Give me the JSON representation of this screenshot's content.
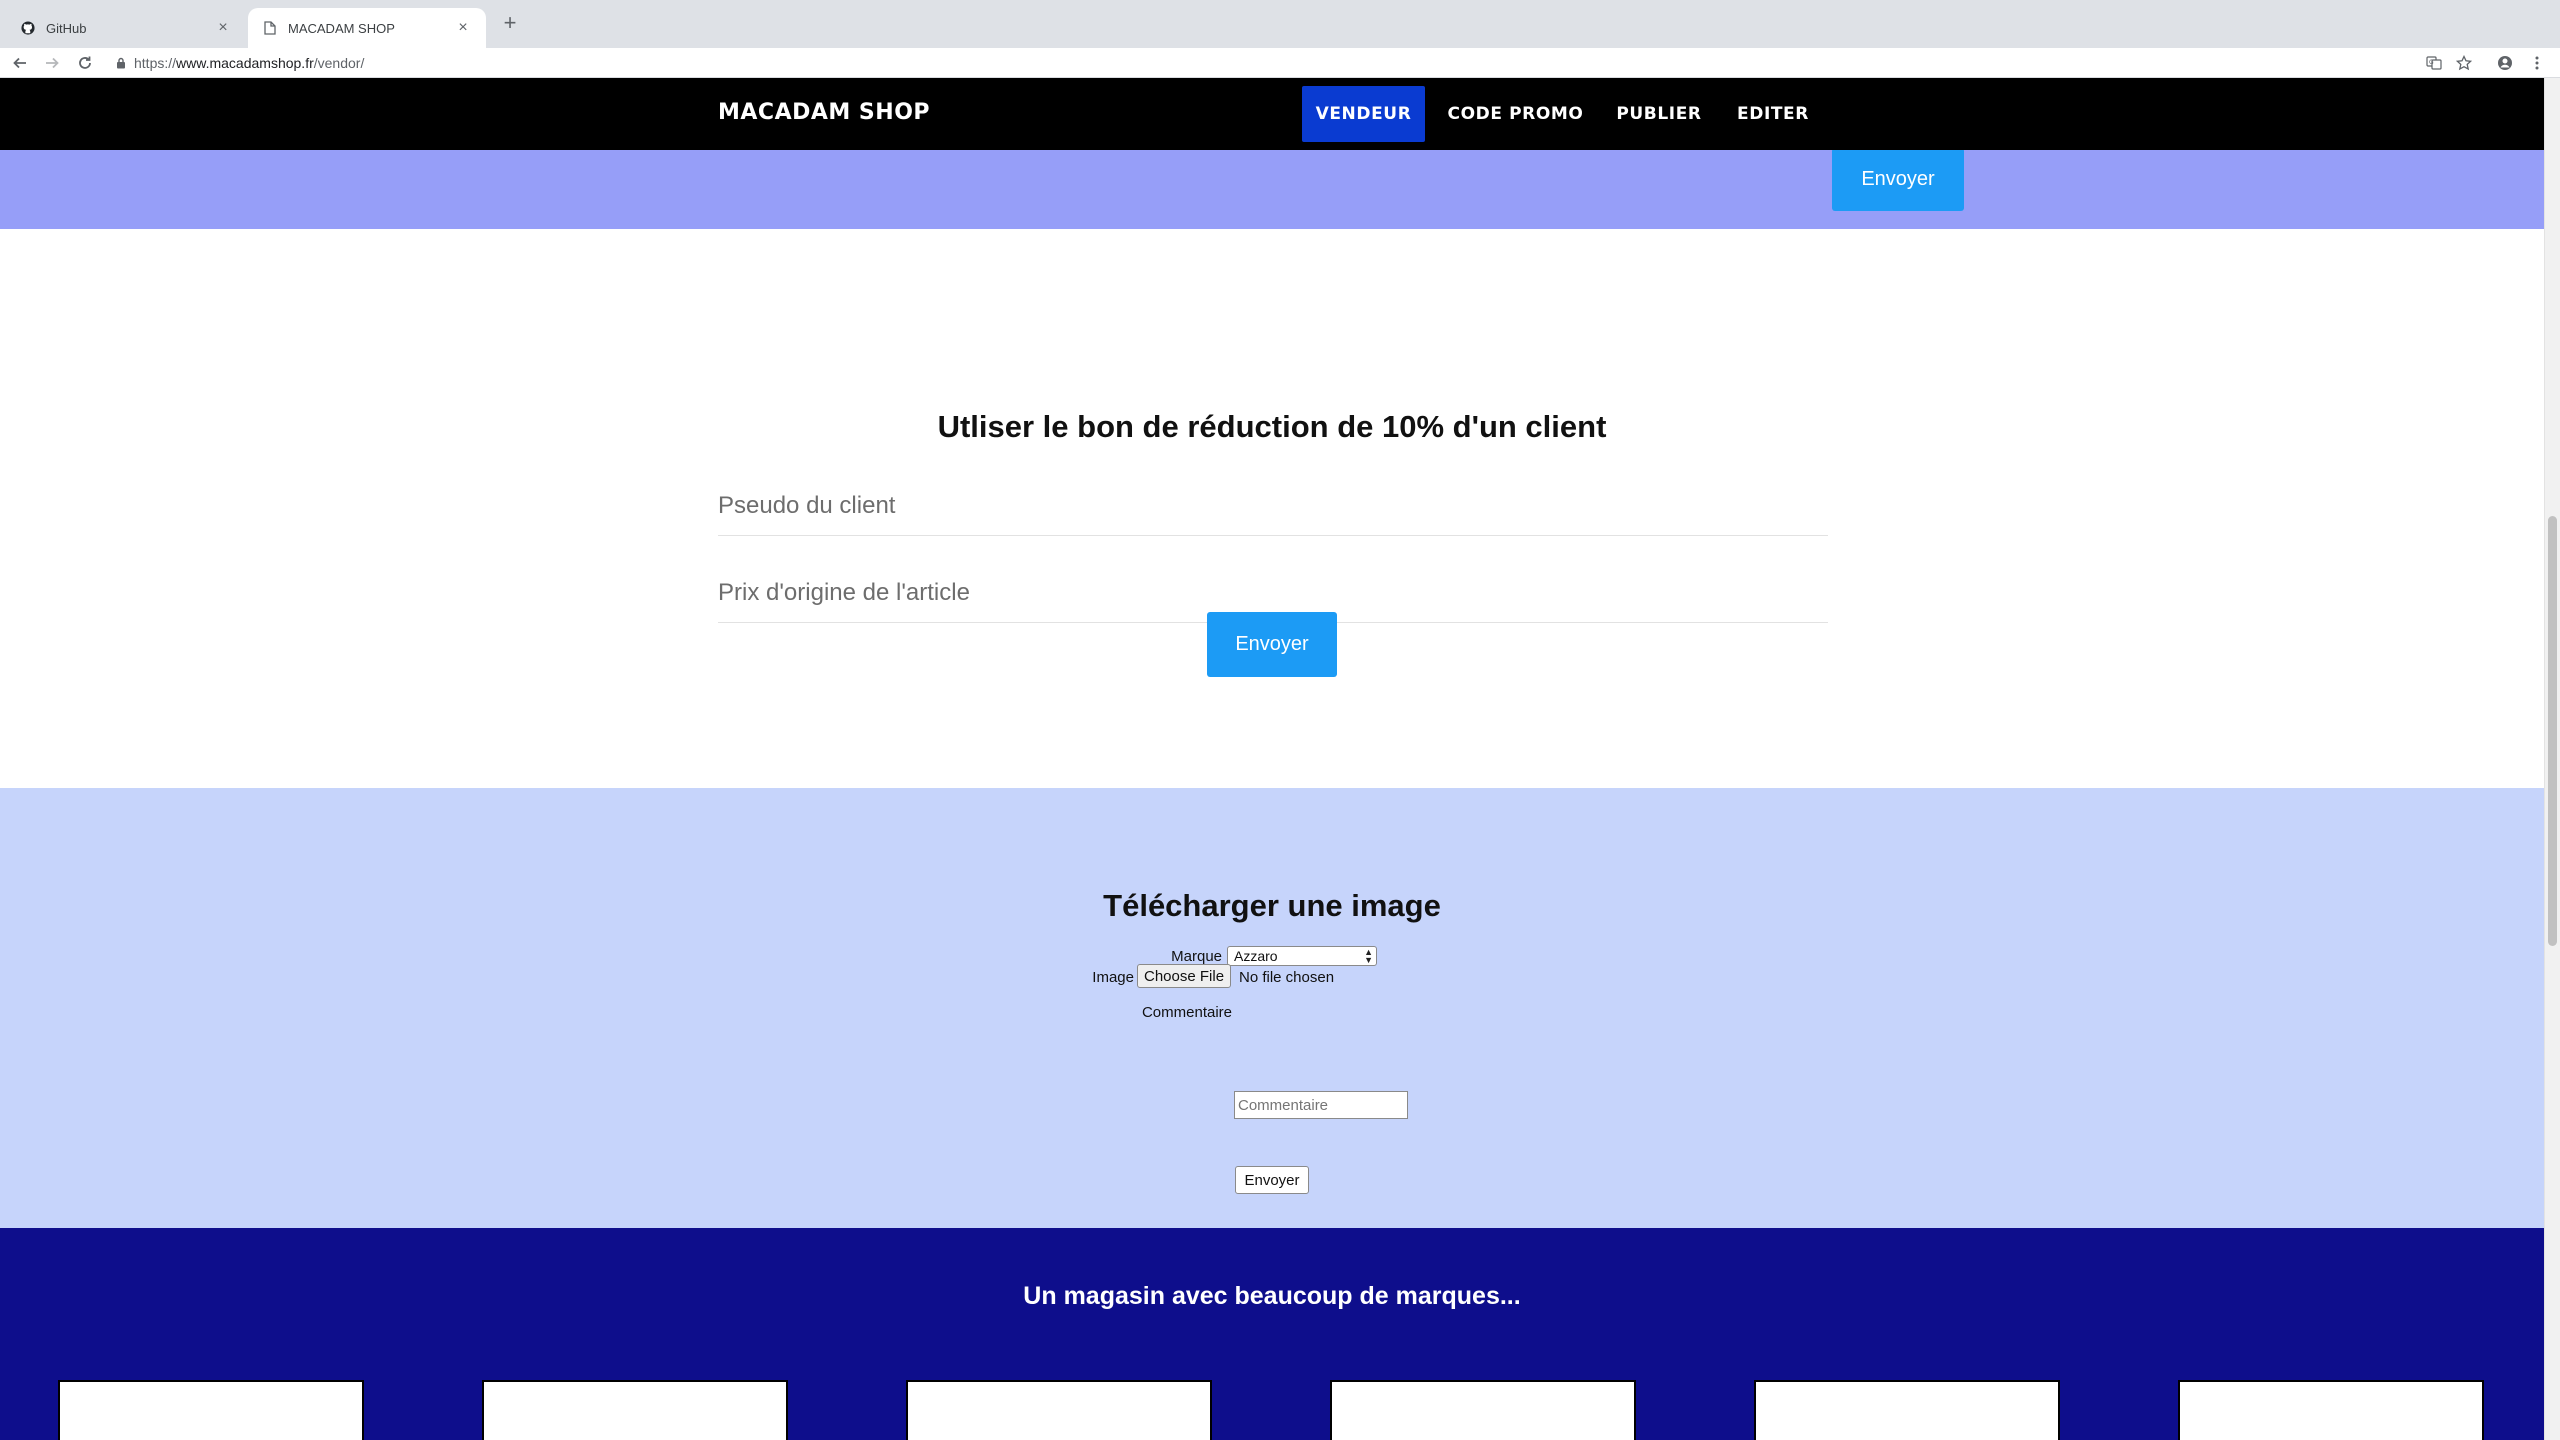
{
  "browser": {
    "tabs": [
      {
        "title": "GitHub",
        "icon": "github-icon",
        "active": false
      },
      {
        "title": "MACADAM SHOP",
        "icon": "page-icon",
        "active": true
      }
    ],
    "url": {
      "scheme": "https://",
      "host": "www.macadamshop.fr",
      "path": "/vendor/"
    }
  },
  "nav": {
    "brand": "MACADAM SHOP",
    "items": [
      {
        "label": "VENDEUR",
        "active": true
      },
      {
        "label": "CODE PROMO",
        "active": false
      },
      {
        "label": "PUBLIER",
        "active": false
      },
      {
        "label": "EDITER",
        "active": false
      }
    ]
  },
  "top_band": {
    "submit_label": "Envoyer"
  },
  "promo": {
    "title": "Utliser le bon de réduction de 10% d'un client",
    "pseudo_placeholder": "Pseudo du client",
    "price_placeholder": "Prix d'origine de l'article",
    "submit_label": "Envoyer"
  },
  "upload": {
    "title": "Télécharger une image",
    "marque_label": "Marque",
    "marque_value": "Azzaro",
    "image_label": "Image",
    "choose_file_label": "Choose File",
    "file_status": "No file chosen",
    "comment_label": "Commentaire",
    "comment_placeholder": "Commentaire",
    "submit_label": "Envoyer"
  },
  "brands": {
    "title": "Un magasin avec beaucoup de marques..."
  },
  "colors": {
    "nav_bg": "#000000",
    "nav_active": "#0a3bd1",
    "top_band": "#969ef8",
    "button_blue": "#1c9bf5",
    "upload_bg": "#c6d4fb",
    "brands_bg": "#0e0e8c"
  }
}
